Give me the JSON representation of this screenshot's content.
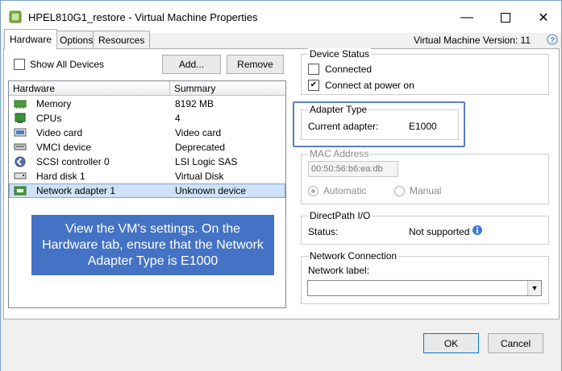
{
  "window": {
    "title": "HPEL810G1_restore - Virtual Machine Properties"
  },
  "tabs": [
    {
      "label": "Hardware",
      "active": true
    },
    {
      "label": "Options",
      "active": false
    },
    {
      "label": "Resources",
      "active": false
    }
  ],
  "vm_version": "Virtual Machine Version: 11",
  "hardware": {
    "show_all_devices": "Show All Devices",
    "add_button": "Add...",
    "remove_button": "Remove",
    "columns": [
      "Hardware",
      "Summary"
    ],
    "rows": [
      {
        "name": "Memory",
        "summary": "8192 MB",
        "icon": "memory-icon"
      },
      {
        "name": "CPUs",
        "summary": "4",
        "icon": "cpu-icon"
      },
      {
        "name": "Video card",
        "summary": "Video card",
        "icon": "video-card-icon"
      },
      {
        "name": "VMCI device",
        "summary": "Deprecated",
        "icon": "vmci-icon"
      },
      {
        "name": "SCSI controller 0",
        "summary": "LSI Logic SAS",
        "icon": "scsi-icon"
      },
      {
        "name": "Hard disk 1",
        "summary": "Virtual Disk",
        "icon": "hard-disk-icon"
      },
      {
        "name": "Network adapter 1",
        "summary": "Unknown device",
        "icon": "network-adapter-icon",
        "selected": true
      }
    ]
  },
  "callout": "View the VM's settings. On the Hardware tab, ensure that the Network Adapter Type is E1000",
  "device_status": {
    "title": "Device Status",
    "connected": "Connected",
    "connect_at_power_on": "Connect at power on"
  },
  "adapter_type": {
    "title": "Adapter Type",
    "label": "Current adapter:",
    "value": "E1000"
  },
  "mac_address": {
    "title": "MAC Address",
    "value": "00:50:56:b6:ea:db",
    "automatic": "Automatic",
    "manual": "Manual"
  },
  "directpath": {
    "title": "DirectPath I/O",
    "label": "Status:",
    "value": "Not supported"
  },
  "network_connection": {
    "title": "Network Connection",
    "label": "Network label:",
    "value": ""
  },
  "footer": {
    "ok": "OK",
    "cancel": "Cancel"
  },
  "colors": {
    "callout": "#4472c4",
    "highlight": "#5b7fbf",
    "selection": "#cfe2f7"
  }
}
